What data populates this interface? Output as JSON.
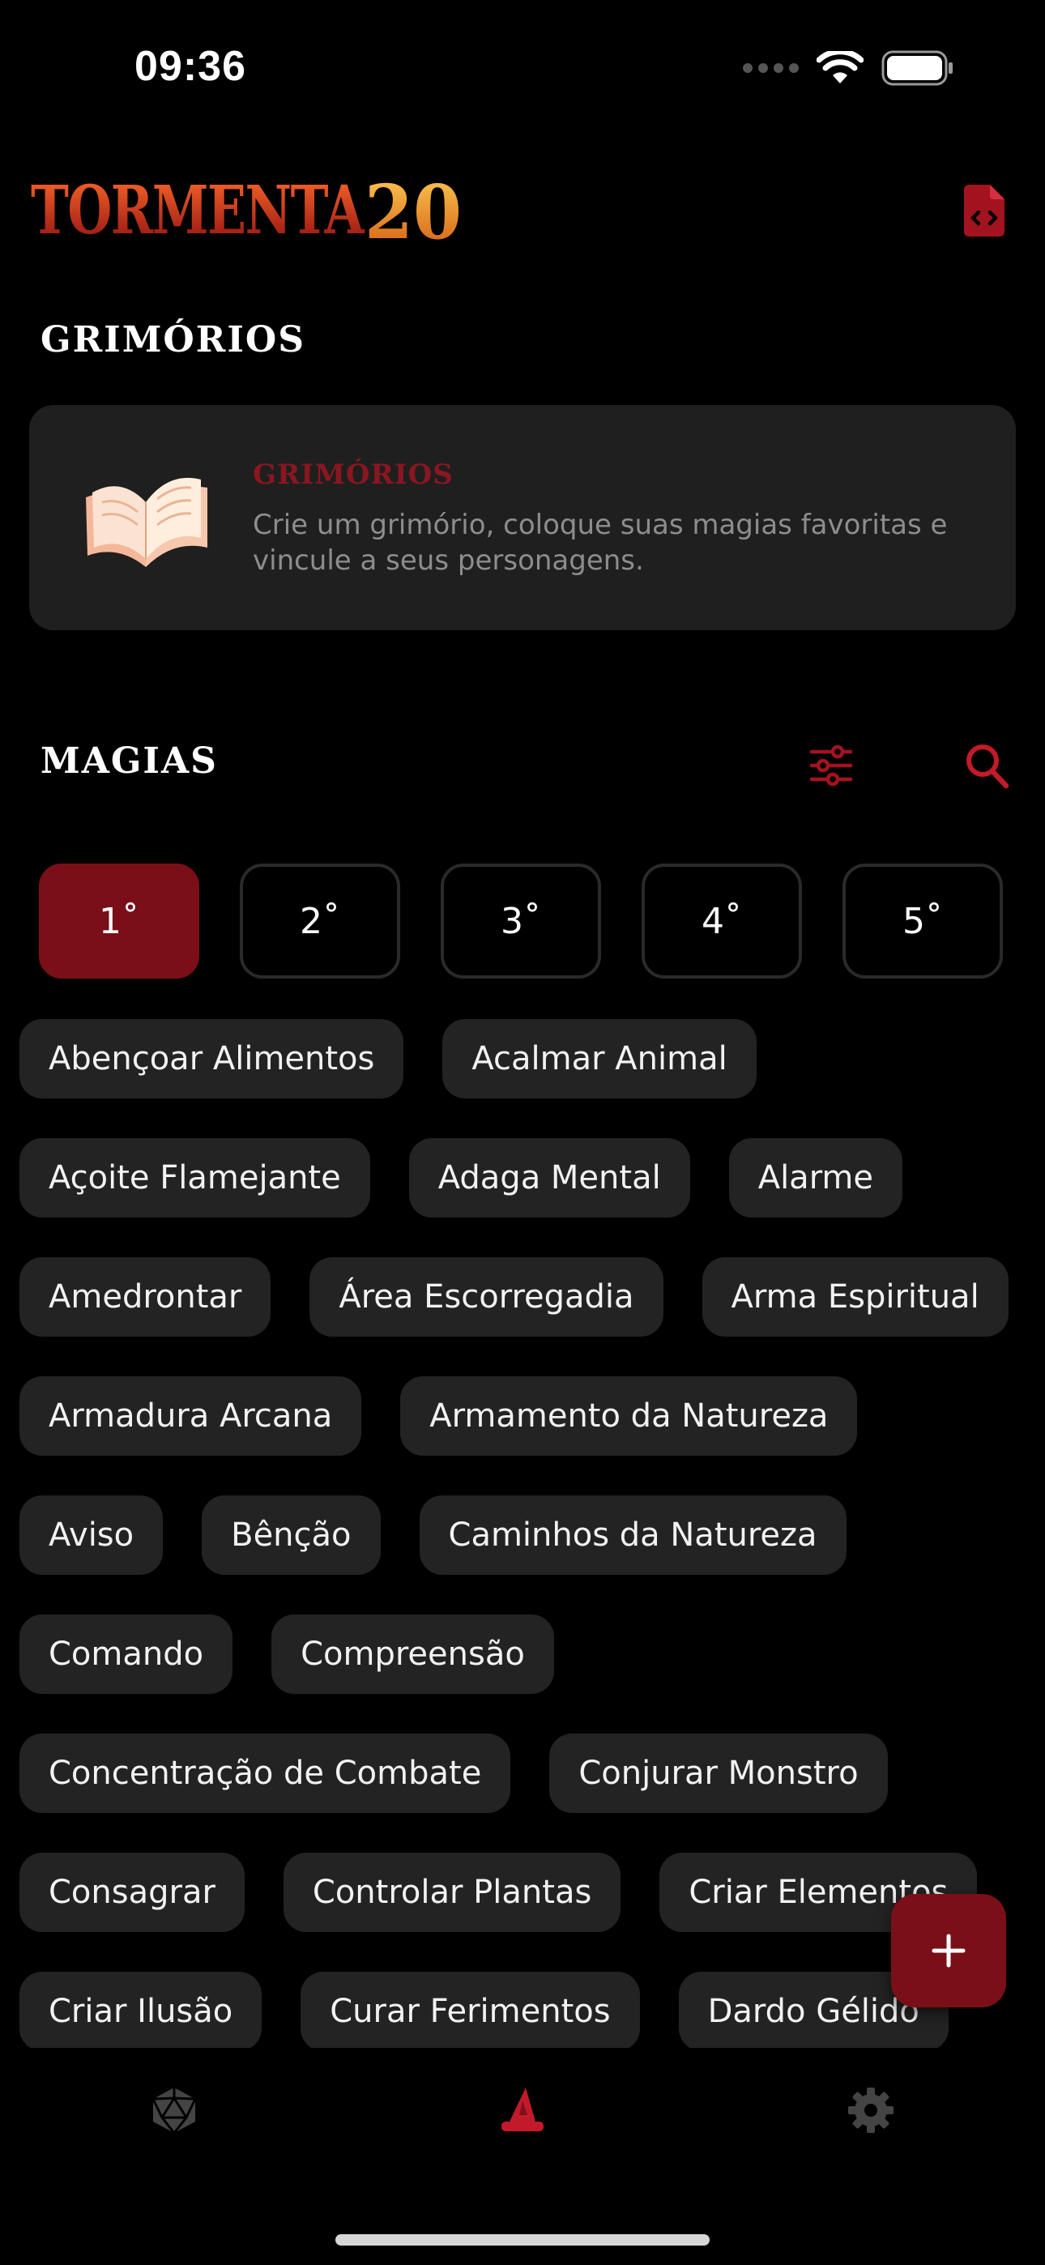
{
  "status_bar": {
    "time": "09:36"
  },
  "header": {
    "logo_text_main": "TORMENTA",
    "logo_text_num": "20"
  },
  "grimorios_section": {
    "title": "GRIMÓRIOS",
    "card_title": "GRIMÓRIOS",
    "card_description": "Crie um grimório, coloque suas magias favoritas e vincule a seus personagens."
  },
  "magias_section": {
    "title": "MAGIAS",
    "levels": [
      {
        "label": "1˚",
        "active": true
      },
      {
        "label": "2˚",
        "active": false
      },
      {
        "label": "3˚",
        "active": false
      },
      {
        "label": "4˚",
        "active": false
      },
      {
        "label": "5˚",
        "active": false
      }
    ],
    "spell_rows": [
      [
        "Abençoar Alimentos",
        "Acalmar Animal"
      ],
      [
        "Açoite Flamejante",
        "Adaga Mental",
        "Alarme"
      ],
      [
        "Amedrontar",
        "Área Escorregadia",
        "Arma Espiritual"
      ],
      [
        "Armadura Arcana",
        "Armamento da Natureza"
      ],
      [
        "Aviso",
        "Bênção",
        "Caminhos da Natureza"
      ],
      [
        "Comando",
        "Compreensão"
      ],
      [
        "Concentração de Combate",
        "Conjurar Monstro"
      ],
      [
        "Consagrar",
        "Controlar Plantas",
        "Criar Elementos"
      ],
      [
        "Criar Ilusão",
        "Curar Ferimentos",
        "Dardo Gélido"
      ]
    ]
  },
  "fab": {
    "label": "+"
  },
  "colors": {
    "accent": "#7a0f18",
    "accent_light": "#c21a2a",
    "chip_bg": "#232323",
    "card_bg": "#1f1f1f"
  },
  "bottom_nav": {
    "items": [
      "d20-icon",
      "wizard-hat-icon",
      "gear-icon"
    ],
    "active": "wizard-hat-icon"
  }
}
